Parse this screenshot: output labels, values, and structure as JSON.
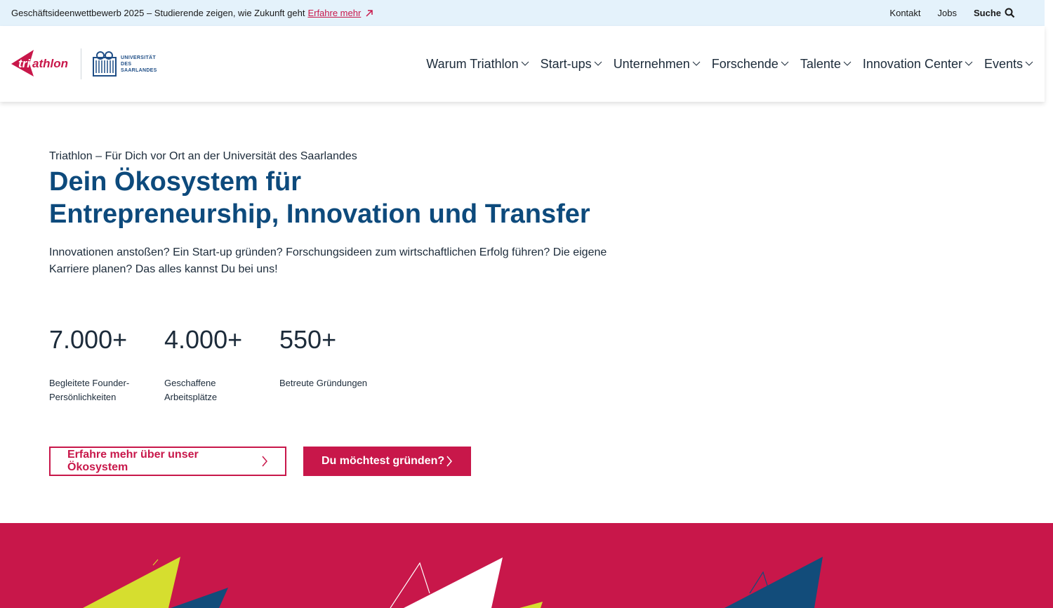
{
  "topbar": {
    "announcement": "Geschäftsideenwettbewerb 2025 – Studierende zeigen, wie Zukunft geht",
    "announcement_link": "Erfahre mehr",
    "links": {
      "contact": "Kontakt",
      "jobs": "Jobs",
      "search": "Suche"
    }
  },
  "header": {
    "logo_text": "triathlon",
    "university_lines": [
      "UNIVERSITÄT",
      "DES",
      "SAARLANDES"
    ],
    "nav": [
      "Warum Triathlon",
      "Start-ups",
      "Unternehmen",
      "Forschende",
      "Talente",
      "Innovation Center",
      "Events"
    ]
  },
  "hero": {
    "kicker": "Triathlon – Für Dich vor Ort an der Universität des Saarlandes",
    "title_line1": "Dein Ökosystem für",
    "title_line2": "Entrepreneurship, Innovation und Transfer",
    "lead": "Innovationen anstoßen? Ein Start-up gründen? Forschungsideen zum wirtschaftlichen Erfolg führen? Die eigene Karriere planen? Das alles kannst Du bei uns!"
  },
  "stats": [
    {
      "value": "7.000+",
      "label": "Begleitete Founder-Persönlichkeiten"
    },
    {
      "value": "4.000+",
      "label": "Geschaffene Arbeitsplätze"
    },
    {
      "value": "550+",
      "label": "Betreute Gründungen"
    }
  ],
  "buttons": {
    "primary_outline": "Erfahre mehr über unser Ökosystem",
    "primary_solid": "Du möchtest gründen?"
  },
  "colors": {
    "brand_red": "#c8174a",
    "brand_blue": "#0d4a7c",
    "topbar_bg": "#e4f2fb",
    "accent_yellow": "#d6de2f",
    "deep_blue": "#124c7a"
  }
}
